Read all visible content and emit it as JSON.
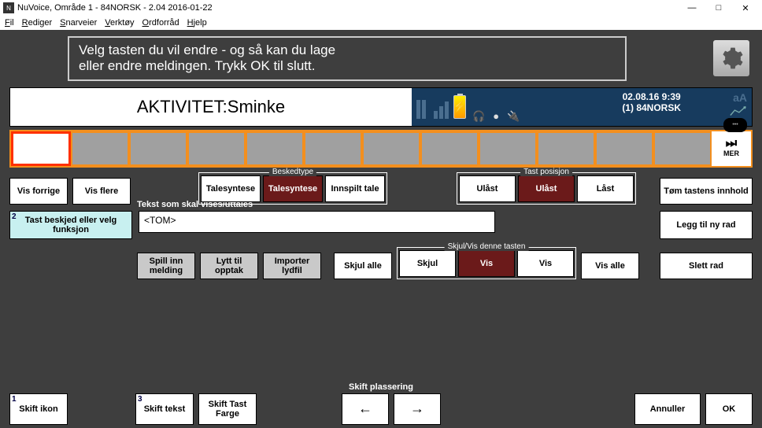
{
  "window": {
    "title": "NuVoice, Område 1 - 84NORSK - 2.04 2016-01-22",
    "min": "—",
    "max": "□",
    "close": "✕"
  },
  "menu": {
    "fil": "Fil",
    "rediger": "Rediger",
    "snarveier": "Snarveier",
    "verktoy": "Verktøy",
    "ordforrad": "Ordforråd",
    "hjelp": "Hjelp"
  },
  "message": {
    "line1": "Velg tasten du vil endre - og så kan du lage",
    "line2": "eller endre meldingen. Trykk OK til slutt."
  },
  "display": "AKTIVITET:Sminke",
  "status": {
    "date": "02.08.16 9:39",
    "profile": "(1) 84NORSK",
    "aA": "aA"
  },
  "mer": "MER",
  "buttons": {
    "vis_forrige": "Vis forrige",
    "vis_flere": "Vis flere",
    "tom_tastens": "Tøm tastens innhold",
    "legg_til_ny_rad": "Legg til ny rad",
    "slett_rad": "Slett rad",
    "annuller": "Annuller",
    "ok": "OK"
  },
  "groups": {
    "beskedtype": {
      "label": "Beskedtype",
      "opt1": "Talesyntese",
      "opt2": "Talesyntese",
      "opt3": "Innspilt tale"
    },
    "tast_posisjon": {
      "label": "Tast posisjon",
      "opt1": "Ulåst",
      "opt2": "Ulåst",
      "opt3": "Låst"
    },
    "skjul_vis": {
      "label": "Skjul/Vis denne tasten",
      "opt1": "Skjul",
      "opt2": "Vis",
      "opt3": "Vis"
    }
  },
  "step2": {
    "num": "2",
    "label": "Tast beskjed eller velg funksjon",
    "text_label": "Tekst som skal vises/uttales",
    "value": "<TOM>"
  },
  "record": {
    "spill_inn": "Spill inn melding",
    "lytt_til": "Lytt til opptak",
    "importer": "Importer lydfil"
  },
  "skjul_alle": "Skjul alle",
  "vis_alle": "Vis alle",
  "bottom": {
    "skift_label": "Skift plassering",
    "s1_num": "1",
    "s1": "Skift ikon",
    "s3_num": "3",
    "s3": "Skift tekst",
    "s_tast_farge": "Skift Tast Farge",
    "left": "←",
    "right": "→"
  }
}
